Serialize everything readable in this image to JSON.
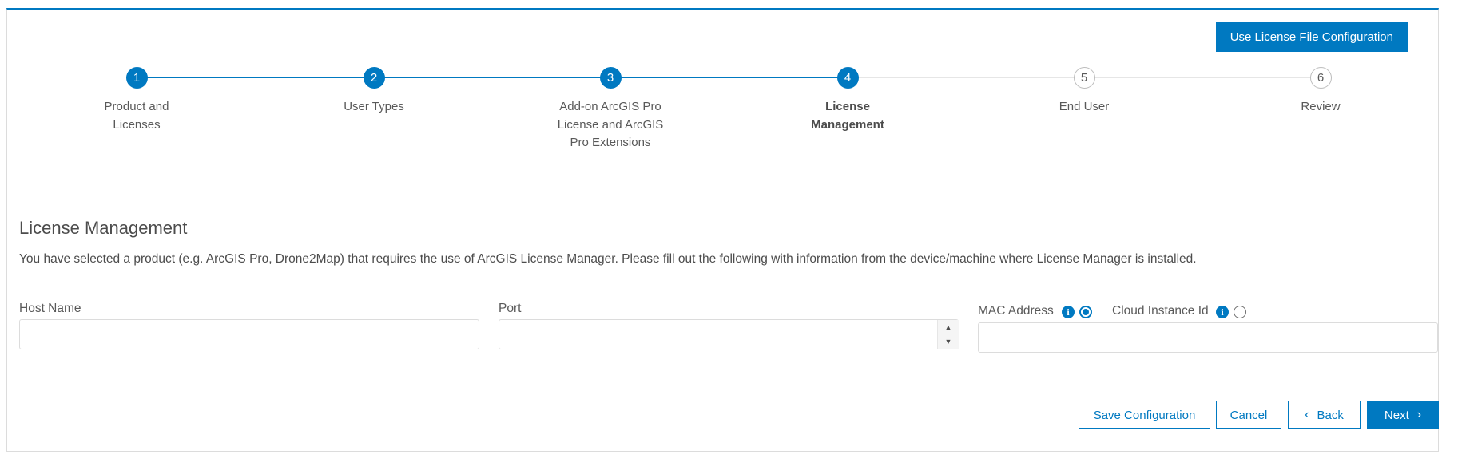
{
  "header": {
    "license_file_button": "Use License File Configuration"
  },
  "stepper": {
    "steps": [
      {
        "number": "1",
        "label": "Product and Licenses"
      },
      {
        "number": "2",
        "label": "User Types"
      },
      {
        "number": "3",
        "label": "Add-on ArcGIS Pro License and ArcGIS Pro Extensions"
      },
      {
        "number": "4",
        "label": "License Management"
      },
      {
        "number": "5",
        "label": "End User"
      },
      {
        "number": "6",
        "label": "Review"
      }
    ],
    "current_step": 4
  },
  "section": {
    "title": "License Management",
    "description": "You have selected a product (e.g. ArcGIS Pro, Drone2Map) that requires the use of ArcGIS License Manager. Please fill out the following with information from the device/machine where License Manager is installed."
  },
  "form": {
    "host_name": {
      "label": "Host Name",
      "value": ""
    },
    "port": {
      "label": "Port",
      "value": ""
    },
    "mac_address": {
      "label": "MAC Address",
      "selected": true
    },
    "cloud_instance_id": {
      "label": "Cloud Instance Id",
      "selected": false
    },
    "identifier_value": ""
  },
  "footer": {
    "save_label": "Save Configuration",
    "cancel_label": "Cancel",
    "back_label": "Back",
    "next_label": "Next"
  },
  "colors": {
    "accent": "#0079c1",
    "border": "#dcdcdc",
    "text": "#4c4c4c"
  },
  "icons": {
    "info": "info-icon",
    "back": "chevron-left-icon",
    "next": "chevron-right-icon",
    "spin_up": "caret-up-icon",
    "spin_down": "caret-down-icon"
  }
}
